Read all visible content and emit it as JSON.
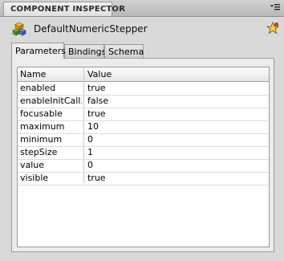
{
  "panel": {
    "title": "COMPONENT INSPECTOR",
    "menu_icon": "panel-menu-icon"
  },
  "component": {
    "icon": "component-cubes-icon",
    "name": "DefaultNumericStepper",
    "star_icon": "star-icon"
  },
  "tabs": [
    {
      "label": "Parameters",
      "active": true
    },
    {
      "label": "Bindings",
      "active": false
    },
    {
      "label": "Schema",
      "active": false
    }
  ],
  "grid": {
    "columns": [
      "Name",
      "Value"
    ],
    "rows": [
      {
        "name": "enabled",
        "value": "true"
      },
      {
        "name": "enableInitCall...",
        "value": "false"
      },
      {
        "name": "focusable",
        "value": "true"
      },
      {
        "name": "maximum",
        "value": "10"
      },
      {
        "name": "minimum",
        "value": "0"
      },
      {
        "name": "stepSize",
        "value": "1"
      },
      {
        "name": "value",
        "value": "0"
      },
      {
        "name": "visible",
        "value": "true"
      }
    ]
  }
}
